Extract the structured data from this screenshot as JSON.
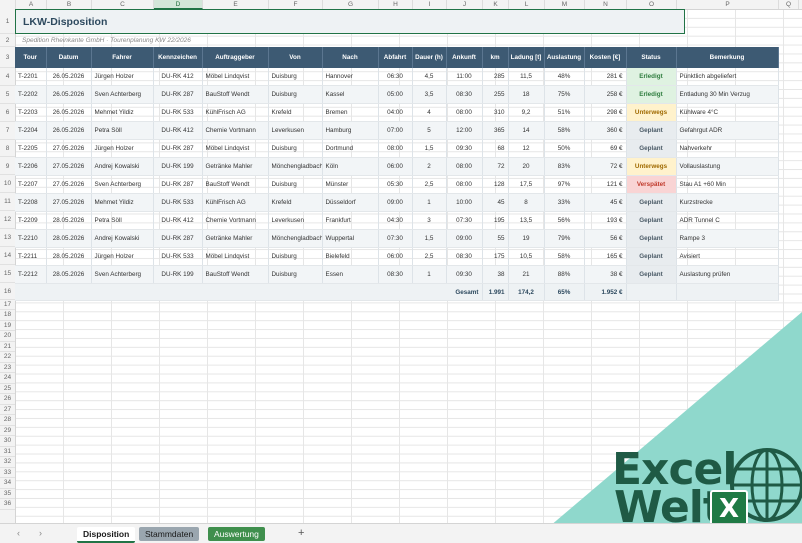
{
  "columns": [
    "A",
    "B",
    "C",
    "D",
    "E",
    "F",
    "G",
    "H",
    "I",
    "J",
    "K",
    "L",
    "M",
    "N",
    "O",
    "P",
    "Q"
  ],
  "rows": [
    "1",
    "2",
    "3",
    "4",
    "5",
    "6",
    "7",
    "8",
    "9",
    "10",
    "11",
    "12",
    "13",
    "14",
    "15",
    "16",
    "17",
    "18",
    "19",
    "20",
    "21",
    "22",
    "23",
    "24",
    "25",
    "26",
    "27",
    "28",
    "29",
    "30",
    "31",
    "32",
    "33",
    "34",
    "35",
    "36"
  ],
  "title": "LKW-Disposition",
  "subtitle": "Spedition Rheinkante GmbH · Tourenplanung KW 22/2026",
  "headers": [
    "Tour",
    "Datum",
    "Fahrer",
    "Kennzeichen",
    "Auftraggeber",
    "Von",
    "Nach",
    "Abfahrt",
    "Dauer (h)",
    "Ankunft",
    "km",
    "Ladung [t]",
    "Auslastung",
    "Kosten [€]",
    "Status",
    "Bemerkung"
  ],
  "tours": [
    [
      "T-2201",
      "26.05.2026",
      "Jürgen Holzer",
      "DU-RK 412",
      "Möbel Lindqvist",
      "Duisburg",
      "Hannover",
      "06:30",
      "4,5",
      "11:00",
      "285",
      "11,5",
      "48%",
      "281 €",
      "Erledigt",
      "Pünktlich abgeliefert"
    ],
    [
      "T-2202",
      "26.05.2026",
      "Sven Achterberg",
      "DU-RK 287",
      "BauStoff Wendt",
      "Duisburg",
      "Kassel",
      "05:00",
      "3,5",
      "08:30",
      "255",
      "18",
      "75%",
      "258 €",
      "Erledigt",
      "Entladung 30 Min Verzug"
    ],
    [
      "T-2203",
      "26.05.2026",
      "Mehmet Yildiz",
      "DU-RK 533",
      "KühlFrisch AG",
      "Krefeld",
      "Bremen",
      "04:00",
      "4",
      "08:00",
      "310",
      "9,2",
      "51%",
      "298 €",
      "Unterwegs",
      "Kühlware 4°C"
    ],
    [
      "T-2204",
      "26.05.2026",
      "Petra Söll",
      "DU-RK 412",
      "Chemie Vortmann",
      "Leverkusen",
      "Hamburg",
      "07:00",
      "5",
      "12:00",
      "365",
      "14",
      "58%",
      "360 €",
      "Geplant",
      "Gefahrgut ADR"
    ],
    [
      "T-2205",
      "27.05.2026",
      "Jürgen Holzer",
      "DU-RK 287",
      "Möbel Lindqvist",
      "Duisburg",
      "Dortmund",
      "08:00",
      "1,5",
      "09:30",
      "68",
      "12",
      "50%",
      "69 €",
      "Geplant",
      "Nahverkehr"
    ],
    [
      "T-2206",
      "27.05.2026",
      "Andrej Kowalski",
      "DU-RK 199",
      "Getränke Mahler",
      "Mönchengladbach",
      "Köln",
      "06:00",
      "2",
      "08:00",
      "72",
      "20",
      "83%",
      "72 €",
      "Unterwegs",
      "Vollauslastung"
    ],
    [
      "T-2207",
      "27.05.2026",
      "Sven Achterberg",
      "DU-RK 287",
      "BauStoff Wendt",
      "Duisburg",
      "Münster",
      "05:30",
      "2,5",
      "08:00",
      "128",
      "17,5",
      "97%",
      "121 €",
      "Verspätet",
      "Stau A1 +60 Min"
    ],
    [
      "T-2208",
      "27.05.2026",
      "Mehmet Yildiz",
      "DU-RK 533",
      "KühlFrisch AG",
      "Krefeld",
      "Düsseldorf",
      "09:00",
      "1",
      "10:00",
      "45",
      "8",
      "33%",
      "45 €",
      "Geplant",
      "Kurzstrecke"
    ],
    [
      "T-2209",
      "28.05.2026",
      "Petra Söll",
      "DU-RK 412",
      "Chemie Vortmann",
      "Leverkusen",
      "Frankfurt",
      "04:30",
      "3",
      "07:30",
      "195",
      "13,5",
      "56%",
      "193 €",
      "Geplant",
      "ADR Tunnel C"
    ],
    [
      "T-2210",
      "28.05.2026",
      "Andrej Kowalski",
      "DU-RK 287",
      "Getränke Mahler",
      "Mönchengladbach",
      "Wuppertal",
      "07:30",
      "1,5",
      "09:00",
      "55",
      "19",
      "79%",
      "56 €",
      "Geplant",
      "Rampe 3"
    ],
    [
      "T-2211",
      "28.05.2026",
      "Jürgen Holzer",
      "DU-RK 533",
      "Möbel Lindqvist",
      "Duisburg",
      "Bielefeld",
      "06:00",
      "2,5",
      "08:30",
      "175",
      "10,5",
      "58%",
      "165 €",
      "Geplant",
      "Avisiert"
    ],
    [
      "T-2212",
      "28.05.2026",
      "Sven Achterberg",
      "DU-RK 199",
      "BauStoff Wendt",
      "Duisburg",
      "Essen",
      "08:30",
      "1",
      "09:30",
      "38",
      "21",
      "88%",
      "38 €",
      "Geplant",
      "Auslastung prüfen"
    ]
  ],
  "totals": {
    "label": "Gesamt",
    "km": "1.991",
    "ladung": "174,2",
    "auslastung": "65%",
    "kosten": "1.952 €"
  },
  "logo": {
    "line1": "Excel",
    "line2": "Welt",
    "badge": "X"
  },
  "tabs": {
    "prev": "‹",
    "next": "›",
    "sheet1": "Disposition",
    "sheet2": "Stammdaten",
    "sheet3": "Auswertung",
    "add": "+"
  },
  "colors": {
    "header": "#3d5a73",
    "accent": "#217346",
    "done": "#2f7d3f",
    "way": "#a06a00",
    "late": "#c0392b"
  }
}
